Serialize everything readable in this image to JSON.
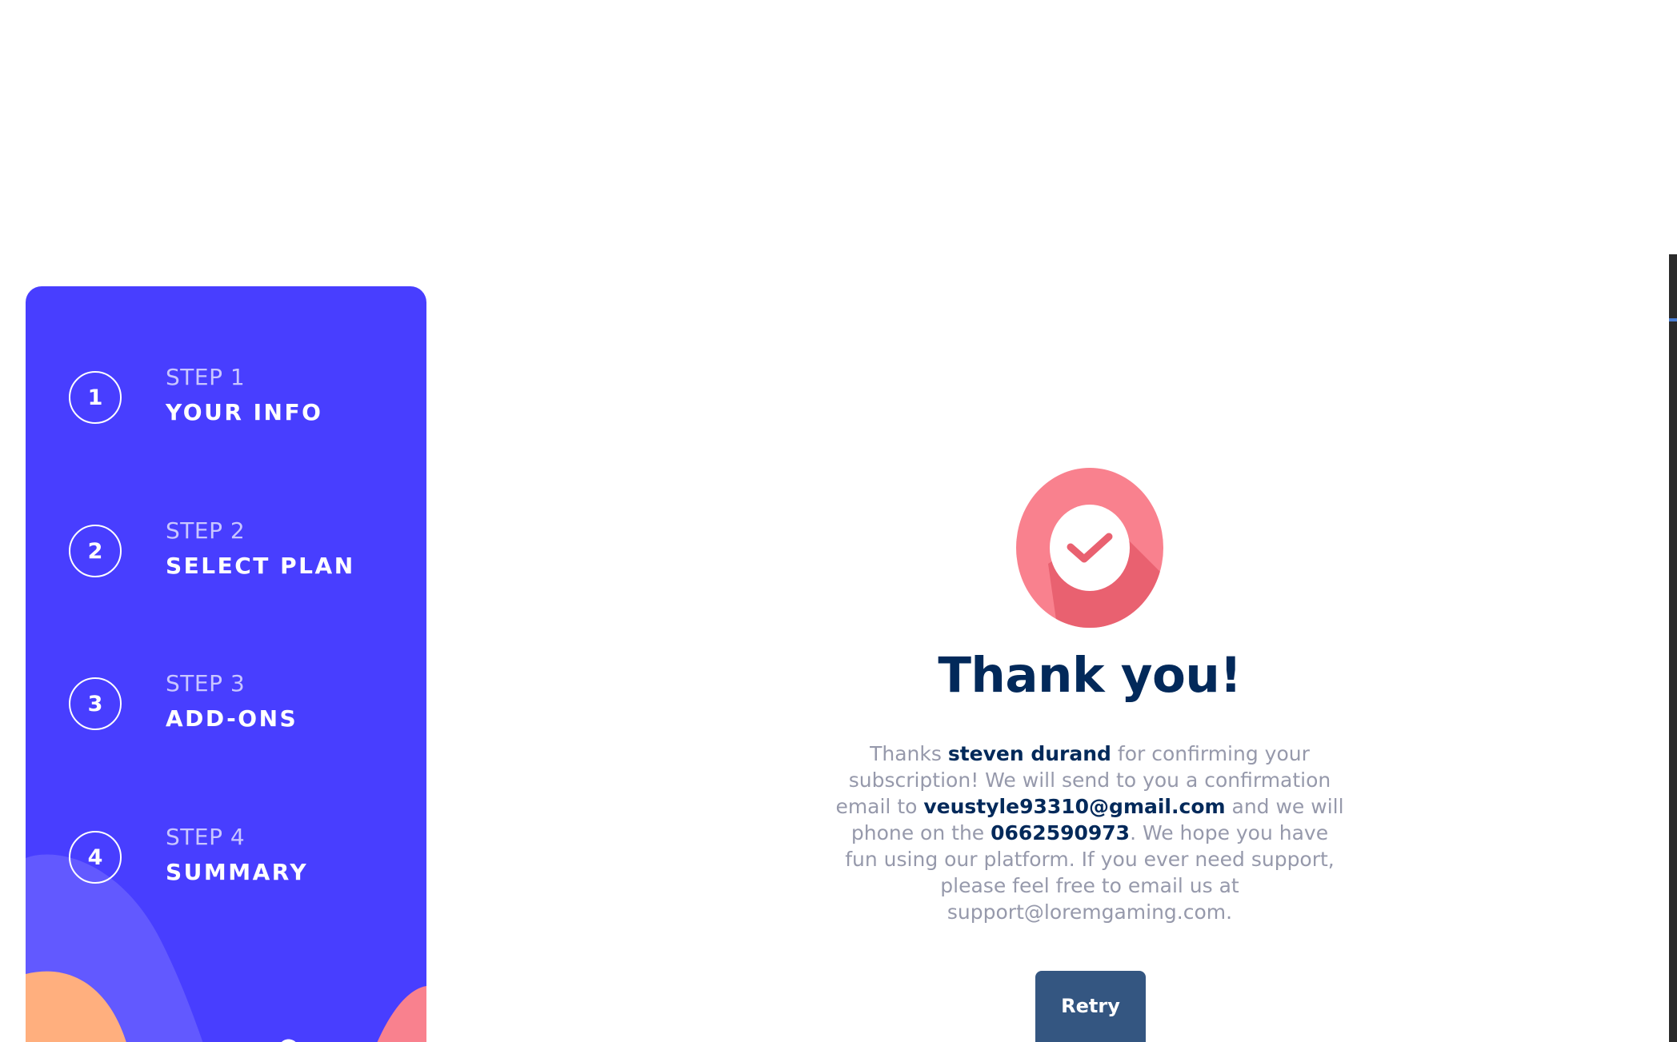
{
  "steps": [
    {
      "number": "1",
      "sub": "STEP 1",
      "title": "YOUR INFO"
    },
    {
      "number": "2",
      "sub": "STEP 2",
      "title": "SELECT PLAN"
    },
    {
      "number": "3",
      "sub": "STEP 3",
      "title": "ADD-ONS"
    },
    {
      "number": "4",
      "sub": "STEP 4",
      "title": "SUMMARY"
    }
  ],
  "confirmation": {
    "title": "Thank you!",
    "msg_1": "Thanks ",
    "name": "steven durand",
    "msg_2": " for confirming your subscription! We will send to you a confirmation email to ",
    "email": "veustyle93310@gmail.com",
    "msg_3": " and we will phone on the ",
    "phone": "0662590973",
    "msg_4": ". We hope you have fun using our platform. If you ever need support, please feel free to email us at support@loremgaming.com."
  },
  "retry_label": "Retry",
  "colors": {
    "sidebar": "#483eff",
    "accent_pink": "#f9818e",
    "dark_blue": "#02295a",
    "button": "#345681",
    "gray_text": "#9699ab"
  },
  "icons": {
    "check": "checkmark-circle-icon"
  }
}
